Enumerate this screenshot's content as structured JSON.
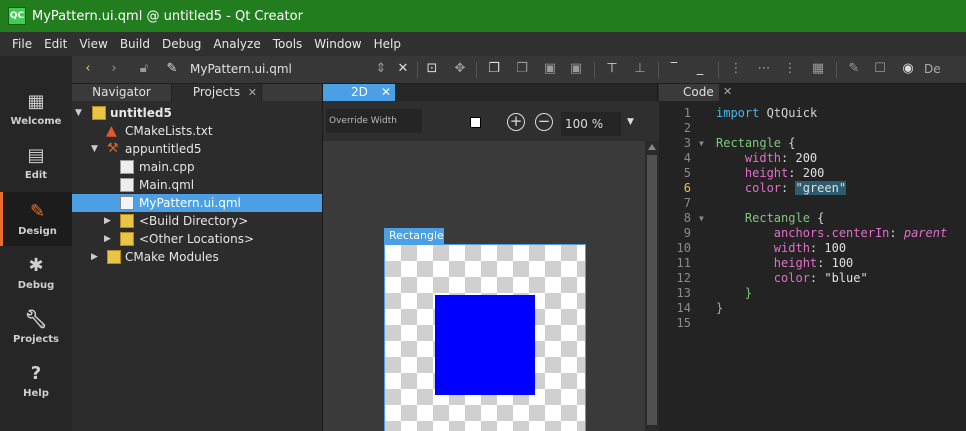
{
  "window": {
    "title": "MyPattern.ui.qml @ untitled5 - Qt Creator",
    "logo": "QC"
  },
  "menu": [
    "File",
    "Edit",
    "View",
    "Build",
    "Debug",
    "Analyze",
    "Tools",
    "Window",
    "Help"
  ],
  "modes": [
    {
      "label": "Welcome",
      "icon": "grid-icon"
    },
    {
      "label": "Edit",
      "icon": "document-icon"
    },
    {
      "label": "Design",
      "icon": "pencil-icon"
    },
    {
      "label": "Debug",
      "icon": "bug-icon"
    },
    {
      "label": "Projects",
      "icon": "wrench-icon"
    },
    {
      "label": "Help",
      "icon": "help-icon"
    }
  ],
  "toolbar": {
    "file": "MyPattern.ui.qml",
    "truncated": "De"
  },
  "left_tabs": [
    "Navigator",
    "Projects"
  ],
  "tree": [
    {
      "label": "untitled5",
      "bold": true
    },
    {
      "label": "CMakeLists.txt"
    },
    {
      "label": "appuntitled5"
    },
    {
      "label": "main.cpp"
    },
    {
      "label": "Main.qml"
    },
    {
      "label": "MyPattern.ui.qml",
      "selected": true
    },
    {
      "label": "<Build Directory>"
    },
    {
      "label": "<Other Locations>"
    },
    {
      "label": "CMake Modules"
    }
  ],
  "center": {
    "tab": "2D",
    "override_width": "Override Width",
    "zoom": "100 %",
    "rect_label": "Rectangle",
    "inner_color": "#0000ff"
  },
  "code_tab": "Code",
  "code_lines": [
    {
      "n": "1",
      "text": "import QtQuick"
    },
    {
      "n": "2",
      "text": ""
    },
    {
      "n": "3",
      "text": "Rectangle {"
    },
    {
      "n": "4",
      "text": "    width: 200"
    },
    {
      "n": "5",
      "text": "    height: 200"
    },
    {
      "n": "6",
      "text": "    color: \"green\""
    },
    {
      "n": "7",
      "text": ""
    },
    {
      "n": "8",
      "text": "    Rectangle {"
    },
    {
      "n": "9",
      "text": "        anchors.centerIn: parent"
    },
    {
      "n": "10",
      "text": "        width: 100"
    },
    {
      "n": "11",
      "text": "        height: 100"
    },
    {
      "n": "12",
      "text": "        color: \"blue\""
    },
    {
      "n": "13",
      "text": "    }"
    },
    {
      "n": "14",
      "text": "}"
    },
    {
      "n": "15",
      "text": ""
    }
  ]
}
